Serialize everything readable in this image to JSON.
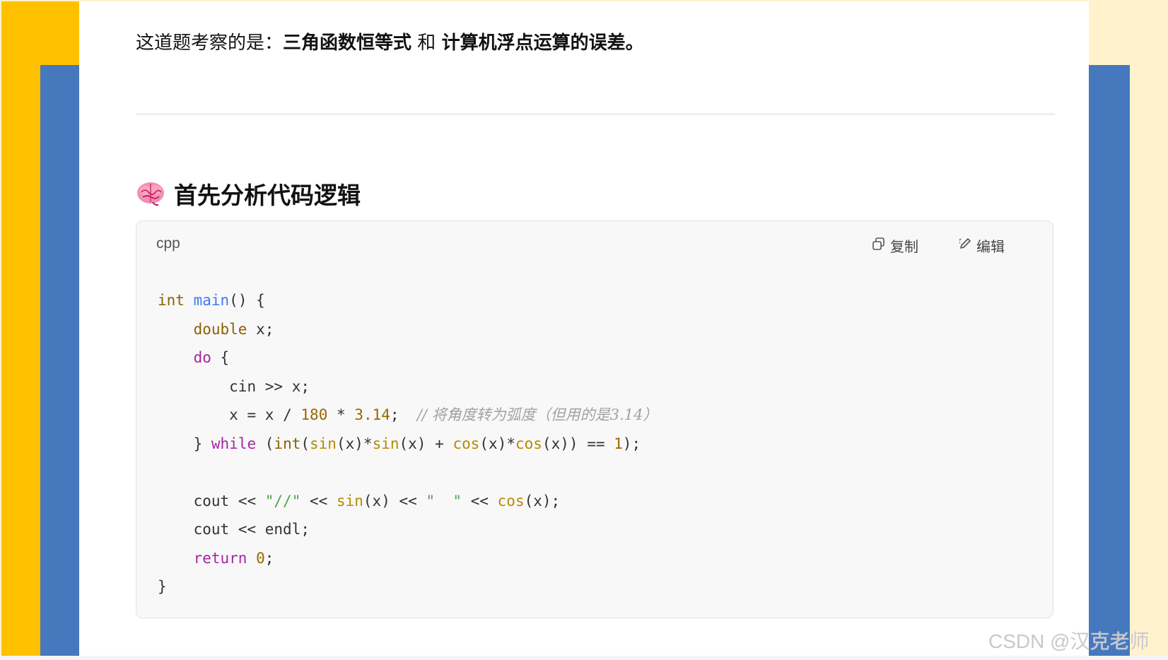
{
  "intro": {
    "prefix": "这道题考察的是：",
    "topic1": "三角函数恒等式",
    "connector": " 和 ",
    "topic2": "计算机浮点运算的误差。"
  },
  "heading": {
    "icon": "brain-icon",
    "title": "首先分析代码逻辑"
  },
  "code_block": {
    "language": "cpp",
    "copy_label": "复制",
    "edit_label": "编辑",
    "lines": [
      "int main() {",
      "    double x;",
      "    do {",
      "        cin >> x;",
      "        x = x / 180 * 3.14;  // 将角度转为弧度（但用的是3.14）",
      "    } while (int(sin(x)*sin(x) + cos(x)*cos(x)) == 1);",
      "",
      "    cout << \"//\" << sin(x) << \"  \" << cos(x);",
      "    cout << endl;",
      "    return 0;",
      "}"
    ]
  },
  "watermark": "CSDN @汉克老师",
  "colors": {
    "left_outer": "#ffc000",
    "blue_band": "#4678bd",
    "right_outer": "#fff2cc",
    "code_background": "#f8f8f8"
  }
}
